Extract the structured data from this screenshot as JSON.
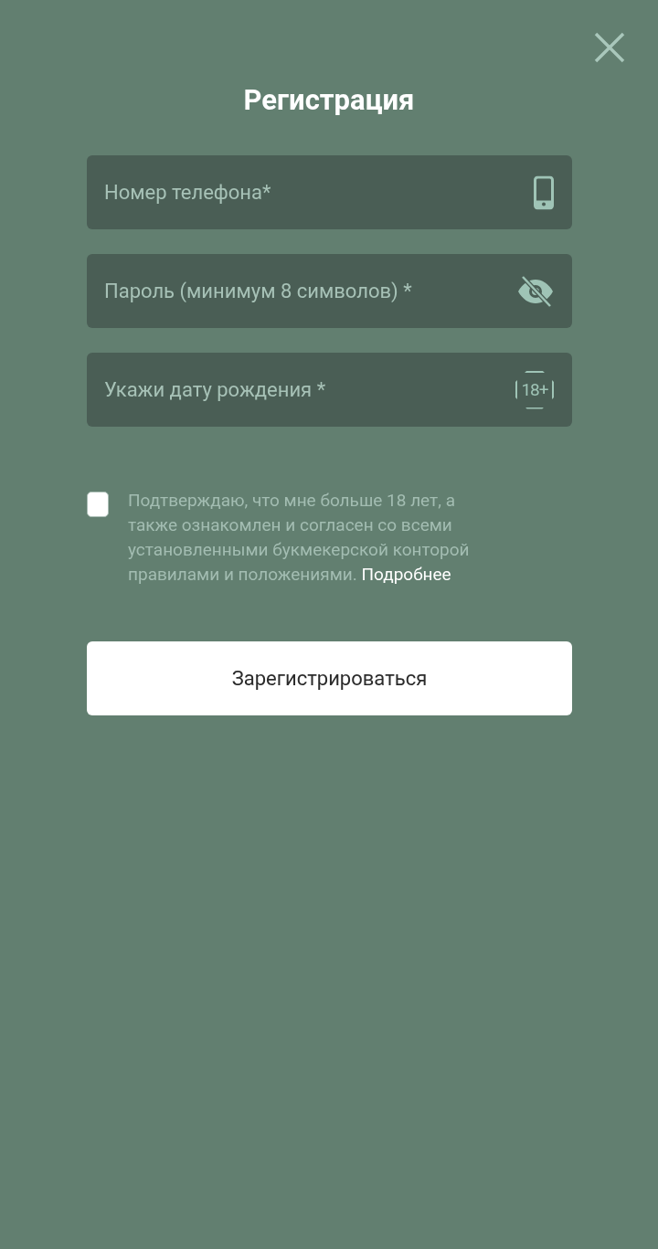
{
  "title": "Регистрация",
  "fields": [
    {
      "kind": "phone",
      "placeholder": "Номер телефона*"
    },
    {
      "kind": "password",
      "placeholder": "Пароль (минимум 8 символов) *"
    },
    {
      "kind": "birthdate",
      "placeholder": "Укажи дату рождения *",
      "badge": "18+"
    }
  ],
  "agreement": {
    "checked": false,
    "text": "Подтверждаю, что мне больше 18 лет, а также ознакомлен и согласен со всеми установленными букмекерской конторой правилами и положениями.",
    "link": "Подробнее"
  },
  "submit_button": "Зарегистрироваться"
}
